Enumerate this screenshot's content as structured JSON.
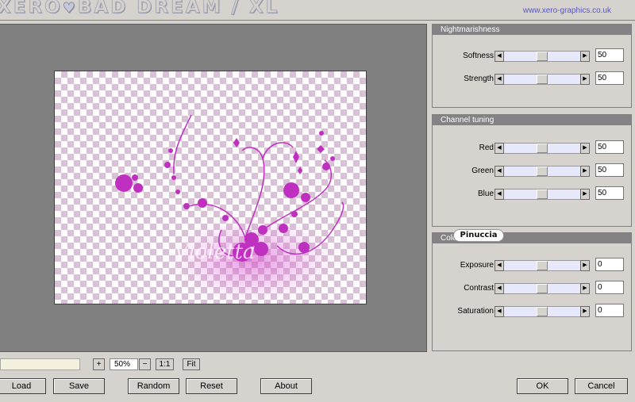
{
  "title": {
    "logo_part1": "XERO",
    "logo_heart": "♥",
    "logo_part2": "BAD DREAM / XL",
    "website": "www.xero-graphics.co.uk"
  },
  "panels": [
    {
      "header": "Nightmarishness",
      "sliders": [
        {
          "label": "Softness",
          "value": "50",
          "fraction": 0.5
        },
        {
          "label": "Strength",
          "value": "50",
          "fraction": 0.5
        }
      ]
    },
    {
      "header": "Channel tuning",
      "sliders": [
        {
          "label": "Red",
          "value": "50",
          "fraction": 0.5
        },
        {
          "label": "Green",
          "value": "50",
          "fraction": 0.5
        },
        {
          "label": "Blue",
          "value": "50",
          "fraction": 0.5
        }
      ]
    },
    {
      "header": "Color",
      "sliders": [
        {
          "label": "Exposure",
          "value": "0",
          "fraction": 0.5
        },
        {
          "label": "Contrast",
          "value": "0",
          "fraction": 0.5
        },
        {
          "label": "Saturation",
          "value": "0",
          "fraction": 0.5
        }
      ]
    }
  ],
  "watermark": "Pinuccia",
  "zoom": {
    "plus": "+",
    "value": "50%",
    "minus": "−",
    "one_to_one": "1:1",
    "fit": "Fit"
  },
  "buttons": {
    "load": "Load",
    "save": "Save",
    "random": "Random",
    "reset": "Reset",
    "about": "About",
    "ok": "OK",
    "cancel": "Cancel"
  },
  "icons": {
    "arrow_left": "◀",
    "arrow_right": "▶"
  },
  "colors": {
    "accent_magenta": "#c030c0",
    "panel_header": "#848284",
    "checker": "#d9c2d6"
  }
}
